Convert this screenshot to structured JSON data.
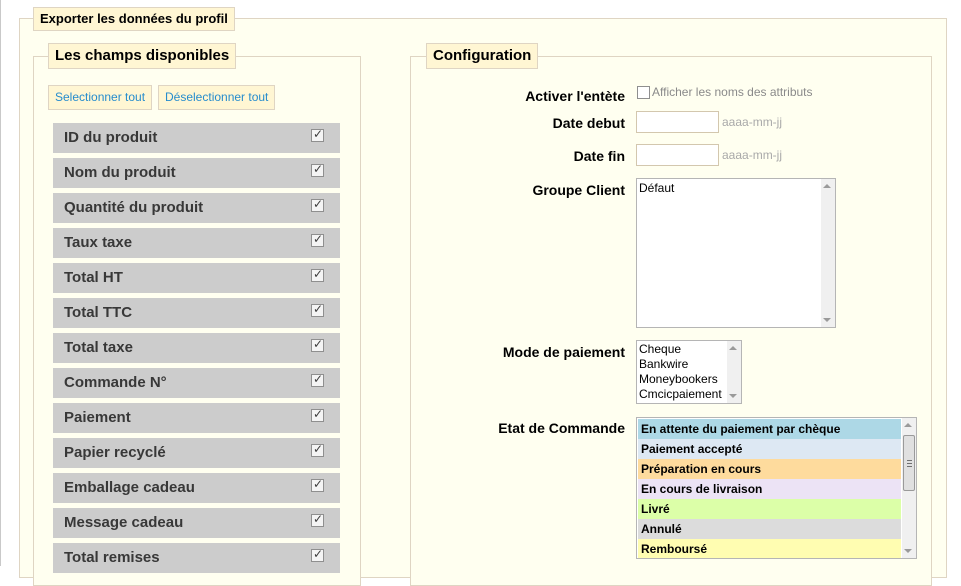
{
  "profile_legend": "Exporter les données du profil",
  "fields_panel": {
    "legend": "Les champs disponibles",
    "select_all": "Selectionner tout",
    "deselect_all": "Déselectionner tout",
    "fields": [
      {
        "label": "ID du produit",
        "checked": true
      },
      {
        "label": "Nom du produit",
        "checked": true
      },
      {
        "label": "Quantité du produit",
        "checked": true
      },
      {
        "label": "Taux taxe",
        "checked": true
      },
      {
        "label": "Total HT",
        "checked": true
      },
      {
        "label": "Total TTC",
        "checked": true
      },
      {
        "label": "Total taxe",
        "checked": true
      },
      {
        "label": "Commande N°",
        "checked": true
      },
      {
        "label": "Paiement",
        "checked": true
      },
      {
        "label": "Papier recyclé",
        "checked": true
      },
      {
        "label": "Emballage cadeau",
        "checked": true
      },
      {
        "label": "Message cadeau",
        "checked": true
      },
      {
        "label": "Total remises",
        "checked": true
      }
    ]
  },
  "config_panel": {
    "legend": "Configuration",
    "header_row": {
      "label": "Activer l'entète",
      "checkbox_label": "Afficher les noms des attributs",
      "checked": false
    },
    "date_start": {
      "label": "Date debut",
      "value": "",
      "hint": "aaaa-mm-jj"
    },
    "date_end": {
      "label": "Date fin",
      "value": "",
      "hint": "aaaa-mm-jj"
    },
    "customer_group": {
      "label": "Groupe Client",
      "options": [
        "Défaut"
      ]
    },
    "payment_mode": {
      "label": "Mode de paiement",
      "options": [
        "Cheque",
        "Bankwire",
        "Moneybookers",
        "Cmcicpaiement"
      ]
    },
    "order_state": {
      "label": "Etat de Commande",
      "options": [
        {
          "label": "En attente du paiement par chèque",
          "color": "#add8e6"
        },
        {
          "label": "Paiement accepté",
          "color": "#dde8f3"
        },
        {
          "label": "Préparation en cours",
          "color": "#fedb9d"
        },
        {
          "label": "En cours de livraison",
          "color": "#ece3f5"
        },
        {
          "label": "Livré",
          "color": "#dcffa8"
        },
        {
          "label": "Annulé",
          "color": "#dcdcdc"
        },
        {
          "label": "Remboursé",
          "color": "#fffdb1"
        }
      ]
    }
  }
}
